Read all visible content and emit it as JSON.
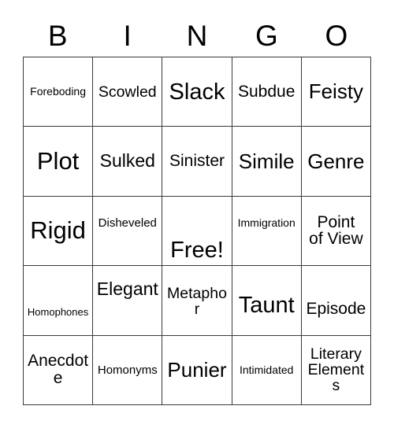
{
  "card": {
    "type": "bingo-card",
    "columns": 5,
    "rows": 5,
    "background_color": "#ffffff",
    "text_color": "#000000",
    "border_color": "#3a3a3a",
    "header": {
      "letters": [
        "B",
        "I",
        "N",
        "G",
        "O"
      ]
    },
    "cells": [
      [
        {
          "label": "Foreboding",
          "size": "fs-14",
          "valign": "va-center"
        },
        {
          "label": "Scowled",
          "size": "fs-19",
          "valign": "va-center"
        },
        {
          "label": "Slack",
          "size": "fs-29",
          "valign": "va-center"
        },
        {
          "label": "Subdue",
          "size": "fs-21",
          "valign": "va-center"
        },
        {
          "label": "Feisty",
          "size": "fs-26",
          "valign": "va-center"
        }
      ],
      [
        {
          "label": "Plot",
          "size": "fs-31",
          "valign": "va-center"
        },
        {
          "label": "Sulked",
          "size": "fs-23",
          "valign": "va-center"
        },
        {
          "label": "Sinister",
          "size": "fs-21",
          "valign": "va-center"
        },
        {
          "label": "Simile",
          "size": "fs-26",
          "valign": "va-center"
        },
        {
          "label": "Genre",
          "size": "fs-26",
          "valign": "va-center"
        }
      ],
      [
        {
          "label": "Rigid",
          "size": "fs-31",
          "valign": "va-center"
        },
        {
          "label": "Disheveled",
          "size": "fs-15",
          "valign": "va-upper"
        },
        {
          "label": "Free!",
          "size": "fs-29",
          "valign": "va-bottom"
        },
        {
          "label": "Immigration",
          "size": "fs-14",
          "valign": "va-upper"
        },
        {
          "label": "Point\nof View",
          "size": "fs-21",
          "valign": "va-center"
        }
      ],
      [
        {
          "label": "Homophones",
          "size": "fs-13",
          "valign": "va-lower"
        },
        {
          "label": "Elegant",
          "size": "fs-23",
          "valign": "va-upper2"
        },
        {
          "label": "Metaphor",
          "size": "fs-19",
          "valign": "va-lower"
        },
        {
          "label": "Taunt",
          "size": "fs-29",
          "valign": "va-lower"
        },
        {
          "label": "Episode",
          "size": "fs-21",
          "valign": "va-lower"
        }
      ],
      [
        {
          "label": "Anecdote",
          "size": "fs-21",
          "valign": "va-center"
        },
        {
          "label": "Homonyms",
          "size": "fs-15",
          "valign": "va-center"
        },
        {
          "label": "Punier",
          "size": "fs-26",
          "valign": "va-center"
        },
        {
          "label": "Intimidated",
          "size": "fs-14",
          "valign": "va-center"
        },
        {
          "label": "Literary\nElements",
          "size": "fs-19",
          "valign": "va-center"
        }
      ]
    ]
  }
}
